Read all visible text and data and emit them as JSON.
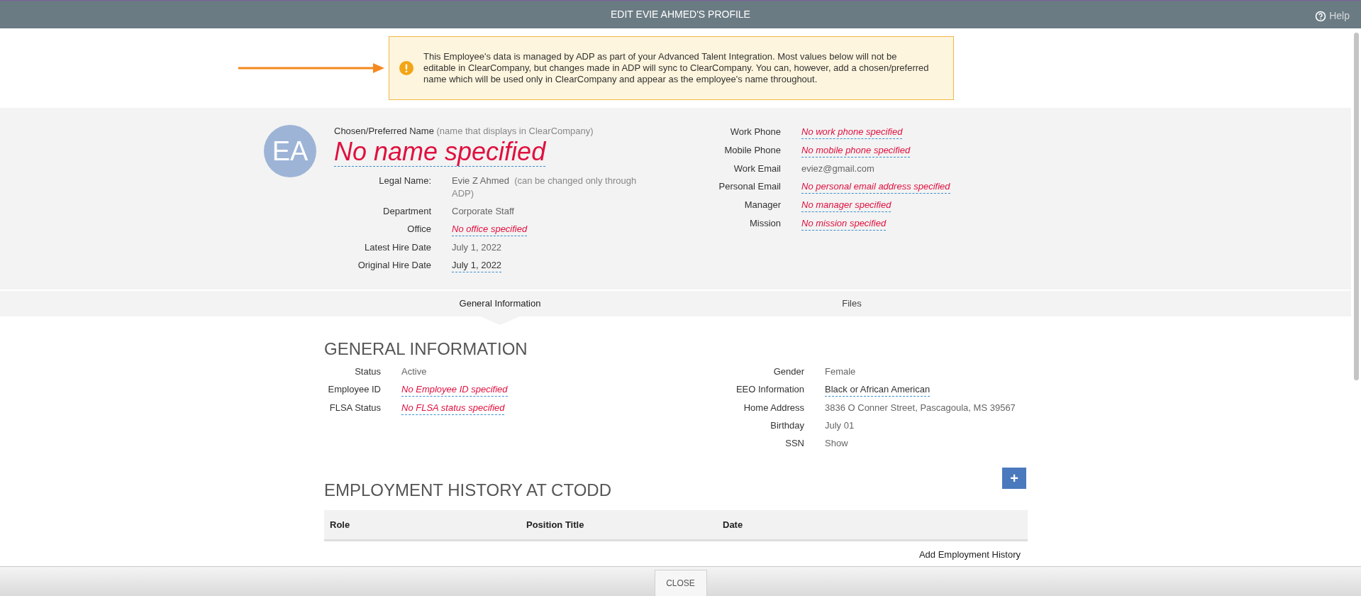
{
  "window": {
    "title": "EDIT EVIE AHMED'S PROFILE",
    "help": "Help"
  },
  "alert": {
    "text": "This Employee's data is managed by ADP as part of your Advanced Talent Integration. Most values below will not be editable in ClearCompany, but changes made in ADP will sync to ClearCompany. You can, however, add a chosen/preferred name which will be used only in ClearCompany and appear as the employee's name throughout."
  },
  "profile": {
    "initials": "EA",
    "name_label": "Chosen/Preferred Name",
    "name_hint": "(name that displays in ClearCompany)",
    "name_value": "No name specified",
    "left_fields": [
      {
        "label": "Legal Name:",
        "kind": "plain",
        "value": "Evie Z Ahmed",
        "note": "(can be changed only through ADP)"
      },
      {
        "label": "Department",
        "kind": "plain",
        "value": "Corporate Staff"
      },
      {
        "label": "Office",
        "kind": "empty",
        "value": "No office specified"
      },
      {
        "label": "Latest Hire Date",
        "kind": "plain",
        "value": "July 1, 2022"
      },
      {
        "label": "Original Hire Date",
        "kind": "editable",
        "value": "July 1, 2022"
      }
    ],
    "right_fields": [
      {
        "label": "Work Phone",
        "kind": "empty",
        "value": "No work phone specified"
      },
      {
        "label": "Mobile Phone",
        "kind": "empty",
        "value": "No mobile phone specified"
      },
      {
        "label": "Work Email",
        "kind": "plain",
        "value": "eviez@gmail.com"
      },
      {
        "label": "Personal Email",
        "kind": "empty",
        "value": "No personal email address specified"
      },
      {
        "label": "Manager",
        "kind": "empty",
        "value": "No manager specified"
      },
      {
        "label": "Mission",
        "kind": "empty",
        "value": "No mission specified"
      }
    ]
  },
  "tabs": [
    {
      "label": "General Information",
      "selected": true
    },
    {
      "label": "Files",
      "selected": false
    }
  ],
  "general": {
    "heading": "GENERAL INFORMATION",
    "left_fields": [
      {
        "label": "Status",
        "kind": "plain",
        "value": "Active"
      },
      {
        "label": "Employee ID",
        "kind": "empty",
        "value": "No Employee ID specified"
      },
      {
        "label": "FLSA Status",
        "kind": "empty",
        "value": "No FLSA status specified"
      }
    ],
    "right_fields": [
      {
        "label": "Gender",
        "kind": "plain",
        "value": "Female"
      },
      {
        "label": "EEO Information",
        "kind": "editable",
        "value": "Black or African American"
      },
      {
        "label": "Home Address",
        "kind": "plain",
        "value": "3836 O Conner Street, Pascagoula, MS 39567"
      },
      {
        "label": "Birthday",
        "kind": "plain",
        "value": "July 01"
      },
      {
        "label": "SSN",
        "kind": "plain",
        "value": "Show"
      }
    ]
  },
  "employment": {
    "heading": "EMPLOYMENT HISTORY AT CTODD",
    "add_icon": "+",
    "columns": [
      "Role",
      "Position Title",
      "Date"
    ],
    "add_link": "Add Employment History"
  },
  "footer": {
    "close": "CLOSE"
  }
}
